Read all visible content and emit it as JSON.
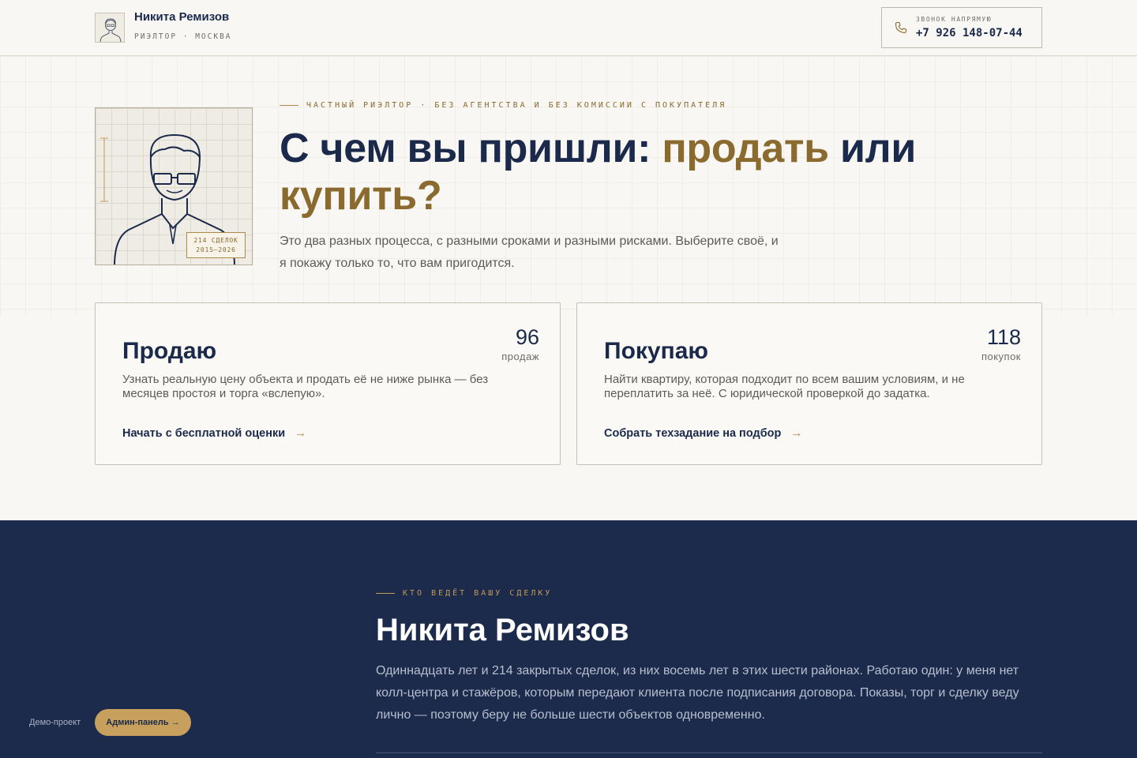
{
  "header": {
    "name": "Никита Ремизов",
    "subtitle": "РИЭЛТОР · МОСКВА",
    "phone_label": "ЗВОНОК НАПРЯМУЮ",
    "phone_number": "+7 926 148-07-44"
  },
  "hero": {
    "eyebrow": "ЧАСТНЫЙ РИЭЛТОР · БЕЗ АГЕНТСТВА И БЕЗ КОМИССИИ С ПОКУПАТЕЛЯ",
    "title_part1": "С чем вы пришли: ",
    "title_accent1": "продать",
    "title_part2": " или ",
    "title_accent2": "купить?",
    "lead": "Это два разных процесса, с разными сроками и разными рисками. Выберите своё, и я покажу только то, что вам пригодится.",
    "badge_line1": "214 СДЕЛОК",
    "badge_line2": "2015—2026"
  },
  "cards": {
    "sell": {
      "title": "Продаю",
      "count": "96",
      "count_unit": "продаж",
      "text": "Узнать реальную цену объекта и продать её не ниже рынка — без месяцев простоя и торга «вслепую».",
      "link": "Начать с бесплатной оценки",
      "arrow": "→"
    },
    "buy": {
      "title": "Покупаю",
      "count": "118",
      "count_unit": "покупок",
      "text": "Найти квартиру, которая подходит по всем вашим условиям, и не переплатить за неё. С юридической проверкой до задатка.",
      "link": "Собрать техзадание на подбор",
      "arrow": "→"
    }
  },
  "about": {
    "eyebrow": "КТО ВЕДЁТ ВАШУ СДЕЛКУ",
    "title": "Никита Ремизов",
    "text": "Одиннадцать лет и 214 закрытых сделок, из них восемь лет в этих шести районах. Работаю один: у меня нет колл-центра и стажёров, которым передают клиента после подписания договора. Показы, торг и сделку веду лично — поэтому беру не больше шести объектов одновременно."
  },
  "demo": {
    "label": "Демо-проект",
    "admin_button": "Админ-панель →"
  },
  "colors": {
    "navy": "#1b2a4b",
    "gold": "#8a6a2e",
    "background": "#f8f7f3",
    "dark_section": "#1c2a4c",
    "button": "#c8a05d"
  },
  "icons": [
    "avatar-icon",
    "phone-icon",
    "portrait-illustration",
    "arrow-right-icon"
  ]
}
